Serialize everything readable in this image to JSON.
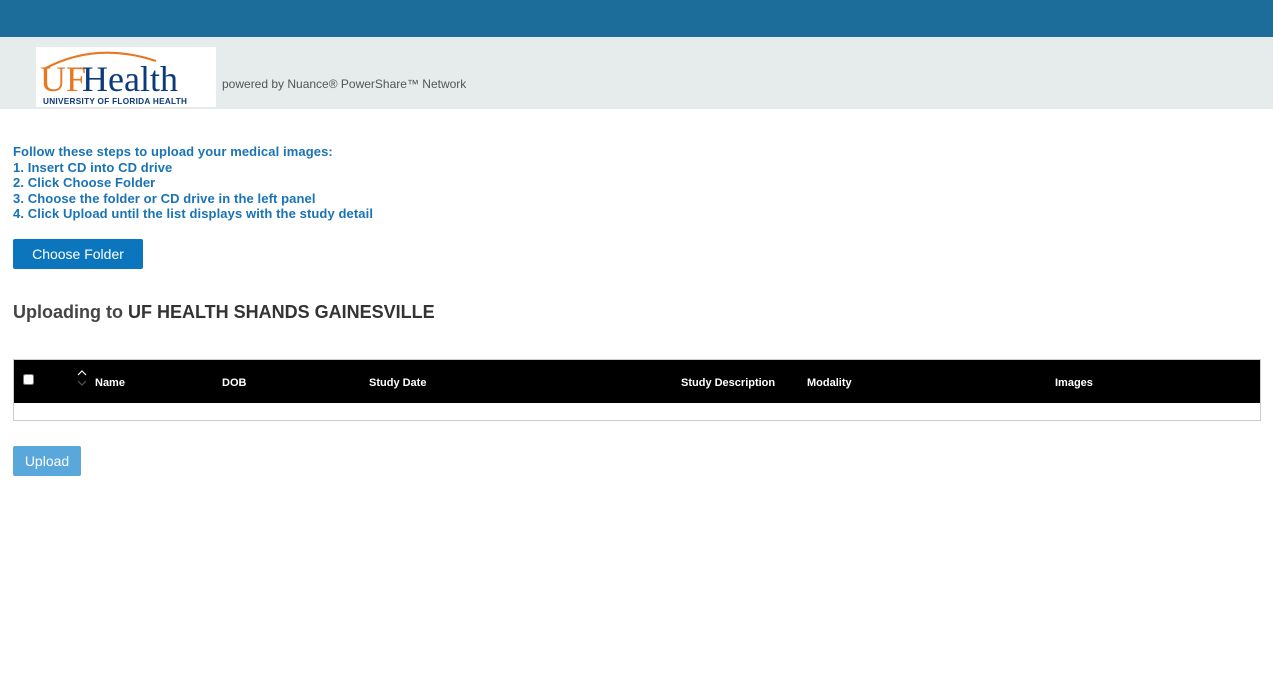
{
  "header": {
    "logo": {
      "brand_uf": "UF",
      "brand_health": "Health",
      "subtitle": "UNIVERSITY OF FLORIDA HEALTH"
    },
    "powered_by": "powered by Nuance® PowerShare™ Network"
  },
  "instructions": {
    "title": "Follow these steps to upload your medical images:",
    "steps": [
      "1. Insert CD into CD drive",
      "2. Click Choose Folder",
      "3. Choose the folder or CD drive in the left panel",
      "4. Click Upload until the list displays with the study detail"
    ]
  },
  "choose_folder_label": "Choose Folder",
  "uploading": {
    "prefix": "Uploading to ",
    "destination": "UF HEALTH SHANDS GAINESVILLE"
  },
  "table": {
    "columns": [
      "Name",
      "DOB",
      "Study Date",
      "Study Description",
      "Modality",
      "Images"
    ],
    "rows": []
  },
  "upload_label": "Upload",
  "colors": {
    "topbar": "#1c6d9a",
    "header_bg": "#e6ebeb",
    "instructions_text": "#1a73b5",
    "primary_button": "#0b76bd",
    "disabled_button": "#5aa7dc",
    "brand_orange": "#e87722",
    "brand_blue": "#0b3b7a"
  },
  "icons": {
    "sort": "sort-up-down-icon",
    "logo_arc": "logo-arc-icon"
  }
}
